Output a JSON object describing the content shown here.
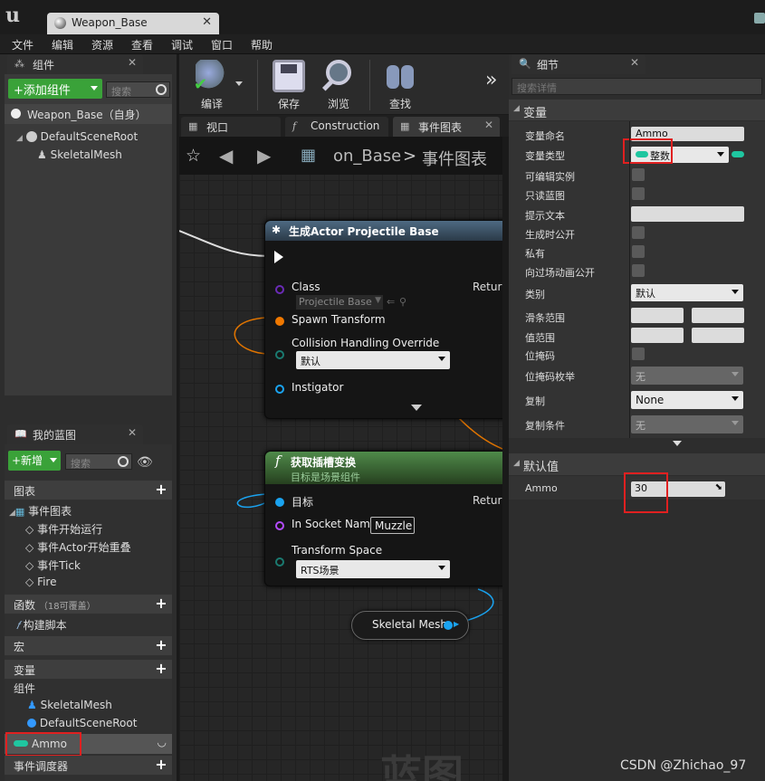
{
  "window": {
    "tab_title": "Weapon_Base",
    "menu": [
      "文件",
      "编辑",
      "资源",
      "查看",
      "调试",
      "窗口",
      "帮助"
    ]
  },
  "components_panel": {
    "tab_label": "组件",
    "add_button": "+添加组件",
    "search_placeholder": "搜索",
    "root_item": "Weapon_Base（自身）",
    "tree": [
      "DefaultSceneRoot",
      "SkeletalMesh"
    ]
  },
  "my_blueprint_panel": {
    "tab_label": "我的蓝图",
    "new_button": "+新增",
    "search_placeholder": "搜索",
    "sections": {
      "graphs": "图表",
      "event_graph": "事件图表",
      "events": [
        "事件开始运行",
        "事件Actor开始重叠",
        "事件Tick",
        "Fire"
      ],
      "functions": "函数",
      "functions_note": "（18可覆盖）",
      "construction_script": "构建脚本",
      "macros": "宏",
      "variables": "变量",
      "components": "组件",
      "component_vars": [
        "SkeletalMesh",
        "DefaultSceneRoot"
      ],
      "selected_var": "Ammo",
      "dispatchers": "事件调度器"
    }
  },
  "toolbar": {
    "compile": "编译",
    "save": "保存",
    "browse": "浏览",
    "find": "查找",
    "more": "»"
  },
  "graph_tabs": [
    "视口",
    "Construction",
    "事件图表"
  ],
  "breadcrumb": {
    "asset": "on_Base",
    "separator": ">",
    "graph": "事件图表"
  },
  "nodes": {
    "spawn": {
      "title": "生成Actor Projectile Base",
      "class_label": "Class",
      "class_value": "Projectile Base",
      "return_label": "Return",
      "spawn_transform": "Spawn Transform",
      "collision_label": "Collision Handling Override",
      "collision_value": "默认",
      "instigator": "Instigator"
    },
    "socket": {
      "title": "获取插槽变换",
      "subtitle": "目标是场景组件",
      "target_label": "目标",
      "return_label": "Return",
      "socket_label": "In Socket Name",
      "socket_value": "Muzzle",
      "space_label": "Transform Space",
      "space_value": "RTS场景"
    },
    "mesh_ref": "Skeletal Mesh"
  },
  "watermark": "蓝图",
  "details": {
    "tab_label": "细节",
    "search_placeholder": "搜索详情",
    "variable_section": "变量",
    "rows": {
      "name_label": "变量命名",
      "name_value": "Ammo",
      "type_label": "变量类型",
      "type_value": "整数",
      "editable_label": "可编辑实例",
      "readonly_label": "只读蓝图",
      "tooltip_label": "提示文本",
      "spawn_label": "生成时公开",
      "private_label": "私有",
      "cinematic_label": "向过场动画公开",
      "category_label": "类别",
      "category_value": "默认",
      "slider_label": "滑条范围",
      "value_range_label": "值范围",
      "bitmask_label": "位掩码",
      "bitmask_enum_label": "位掩码枚举",
      "bitmask_enum_value": "无",
      "replication_label": "复制",
      "replication_value": "None",
      "rep_condition_label": "复制条件",
      "rep_condition_value": "无"
    },
    "default_section": "默认值",
    "default_label": "Ammo",
    "default_value": "30"
  },
  "watermark_credit": "CSDN @Zhichao_97",
  "colors": {
    "accent_green": "#3aa239",
    "highlight_red": "#e02020",
    "int_pin": "#1fc6a0",
    "exec_white": "#ffffff",
    "object_blue": "#1aa3f0",
    "struct_orange": "#f07800",
    "class_purple": "#6a2bb6"
  }
}
